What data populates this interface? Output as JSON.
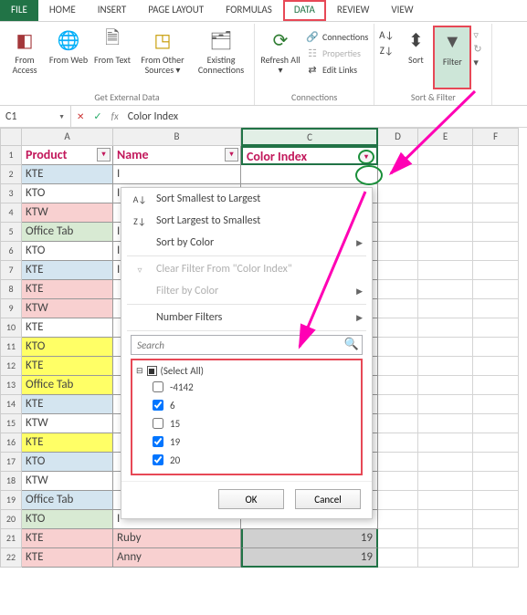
{
  "tabs": {
    "file": "FILE",
    "home": "HOME",
    "insert": "INSERT",
    "pagelayout": "PAGE LAYOUT",
    "formulas": "FORMULAS",
    "data": "DATA",
    "review": "REVIEW",
    "view": "VIEW"
  },
  "ribbon": {
    "ext_group": "Get External Data",
    "from_access": "From\nAccess",
    "from_web": "From\nWeb",
    "from_text": "From\nText",
    "from_other": "From Other\nSources ▾",
    "existing": "Existing\nConnections",
    "conn_group": "Connections",
    "refresh": "Refresh\nAll ▾",
    "connections": "Connections",
    "properties": "Properties",
    "editlinks": "Edit Links",
    "sortfilter_group": "Sort & Filter",
    "sort": "Sort",
    "filter": "Filter"
  },
  "namebox": "C1",
  "fx_label": "fx",
  "formula": "Color Index",
  "colheads": [
    "A",
    "B",
    "C",
    "D",
    "E",
    "F"
  ],
  "headers": {
    "product": "Product",
    "name": "Name",
    "color": "Color Index"
  },
  "rows": [
    {
      "n": 1,
      "a": "Product",
      "b": "Name",
      "c": "Color Index",
      "hdr": true
    },
    {
      "n": 2,
      "a": "KTE",
      "b": "I",
      "c": "",
      "fa": "bg-ltblue",
      "fb": "bg-white",
      "fc": "bg-white"
    },
    {
      "n": 3,
      "a": "KTO",
      "b": "I",
      "c": "",
      "fa": "bg-white",
      "fb": "bg-white",
      "fc": "bg-white"
    },
    {
      "n": 4,
      "a": "KTW",
      "b": "",
      "c": "",
      "fa": "bg-pink",
      "fb": "bg-white",
      "fc": "bg-white"
    },
    {
      "n": 5,
      "a": "Office Tab",
      "b": "I",
      "c": "",
      "fa": "bg-ltgrn",
      "fb": "bg-white",
      "fc": "bg-white"
    },
    {
      "n": 6,
      "a": "KTO",
      "b": "I",
      "c": "",
      "fa": "bg-white",
      "fb": "bg-white",
      "fc": "bg-white"
    },
    {
      "n": 7,
      "a": "KTE",
      "b": "I",
      "c": "",
      "fa": "bg-ltblue",
      "fb": "bg-white",
      "fc": "bg-white"
    },
    {
      "n": 8,
      "a": "KTE",
      "b": "",
      "c": "",
      "fa": "bg-pink",
      "fb": "bg-white",
      "fc": "bg-white"
    },
    {
      "n": 9,
      "a": "KTW",
      "b": "",
      "c": "",
      "fa": "bg-pink",
      "fb": "bg-white",
      "fc": "bg-white"
    },
    {
      "n": 10,
      "a": "KTE",
      "b": "",
      "c": "",
      "fa": "bg-white",
      "fb": "bg-white",
      "fc": "bg-white"
    },
    {
      "n": 11,
      "a": "KTO",
      "b": "",
      "c": "",
      "fa": "bg-yellw",
      "fb": "bg-white",
      "fc": "bg-white"
    },
    {
      "n": 12,
      "a": "KTE",
      "b": "",
      "c": "",
      "fa": "bg-yellw",
      "fb": "bg-white",
      "fc": "bg-white"
    },
    {
      "n": 13,
      "a": "Office Tab",
      "b": "",
      "c": "",
      "fa": "bg-yellw",
      "fb": "bg-white",
      "fc": "bg-white"
    },
    {
      "n": 14,
      "a": "KTE",
      "b": "",
      "c": "",
      "fa": "bg-ltblue",
      "fb": "bg-white",
      "fc": "bg-white"
    },
    {
      "n": 15,
      "a": "KTW",
      "b": "",
      "c": "",
      "fa": "bg-white",
      "fb": "bg-white",
      "fc": "bg-white"
    },
    {
      "n": 16,
      "a": "KTE",
      "b": "",
      "c": "",
      "fa": "bg-yellw",
      "fb": "bg-white",
      "fc": "bg-white"
    },
    {
      "n": 17,
      "a": "KTO",
      "b": "",
      "c": "",
      "fa": "bg-ltblue",
      "fb": "bg-white",
      "fc": "bg-white"
    },
    {
      "n": 18,
      "a": "KTW",
      "b": "",
      "c": "",
      "fa": "bg-white",
      "fb": "bg-white",
      "fc": "bg-white"
    },
    {
      "n": 19,
      "a": "Office Tab",
      "b": "",
      "c": "",
      "fa": "bg-ltblue",
      "fb": "bg-white",
      "fc": "bg-white"
    },
    {
      "n": 20,
      "a": "KTO",
      "b": "I",
      "c": "",
      "fa": "bg-ltgrn",
      "fb": "bg-white",
      "fc": "bg-white"
    },
    {
      "n": 21,
      "a": "KTE",
      "b": "Ruby",
      "c": "19",
      "fa": "bg-pink",
      "fb": "bg-pink",
      "fc": "bg-gray",
      "sel": true
    },
    {
      "n": 22,
      "a": "KTE",
      "b": "Anny",
      "c": "19",
      "fa": "bg-pink",
      "fb": "bg-pink",
      "fc": "bg-gray",
      "sel": true
    }
  ],
  "filter_menu": {
    "sort_asc": "Sort Smallest to Largest",
    "sort_desc": "Sort Largest to Smallest",
    "sort_color": "Sort by Color",
    "clear": "Clear Filter From \"Color Index\"",
    "filter_color": "Filter by Color",
    "number_filters": "Number Filters",
    "search_placeholder": "Search",
    "select_all": "(Select All)",
    "items": [
      {
        "label": "-4142",
        "checked": false
      },
      {
        "label": "6",
        "checked": true
      },
      {
        "label": "15",
        "checked": false
      },
      {
        "label": "19",
        "checked": true
      },
      {
        "label": "20",
        "checked": true
      }
    ],
    "ok": "OK",
    "cancel": "Cancel"
  }
}
